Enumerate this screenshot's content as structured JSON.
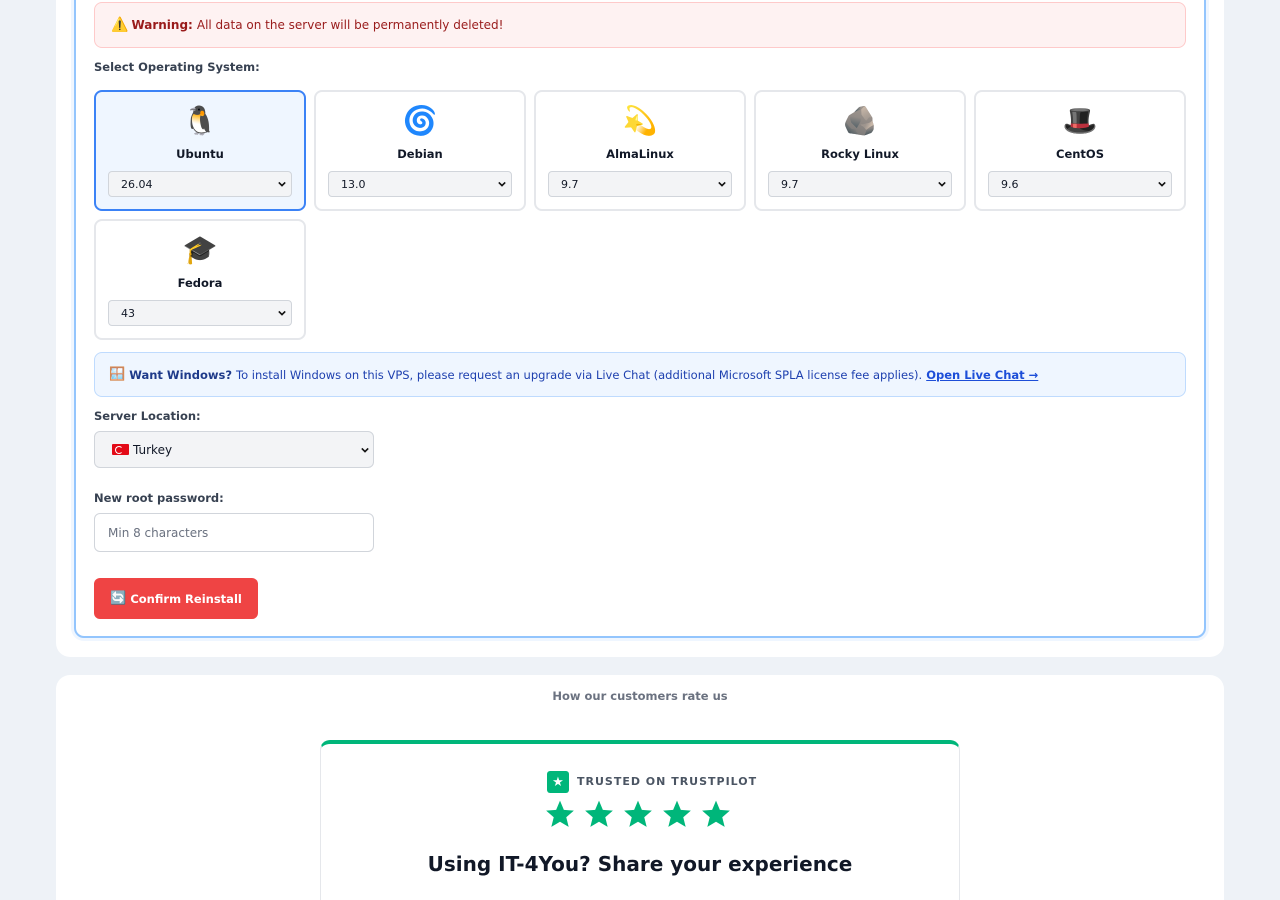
{
  "warning": {
    "icon": "warning-icon",
    "title": "Warning:",
    "text": "All data on the server will be permanently deleted!"
  },
  "os_section": {
    "label": "Select Operating System:",
    "options": [
      {
        "name": "Ubuntu",
        "icon": "🐧",
        "icon_name": "penguin-icon",
        "version": "26.04",
        "selected": true
      },
      {
        "name": "Debian",
        "icon": "🌀",
        "icon_name": "swirl-icon",
        "version": "13.0",
        "selected": false
      },
      {
        "name": "AlmaLinux",
        "icon": "💫",
        "icon_name": "dizzy-star-icon",
        "version": "9.7",
        "selected": false
      },
      {
        "name": "Rocky Linux",
        "icon": "🪨",
        "icon_name": "rock-icon",
        "version": "9.7",
        "selected": false
      },
      {
        "name": "CentOS",
        "icon": "🎩",
        "icon_name": "top-hat-icon",
        "version": "9.6",
        "selected": false
      },
      {
        "name": "Fedora",
        "icon": "🎓",
        "icon_name": "graduation-cap-icon",
        "version": "43",
        "selected": false
      }
    ]
  },
  "windows_note": {
    "icon": "🪟",
    "title": "Want Windows?",
    "text": "To install Windows on this VPS, please request an upgrade via Live Chat (additional Microsoft SPLA license fee applies).",
    "link": "Open Live Chat →"
  },
  "location": {
    "label": "Server Location:",
    "value": "Turkey",
    "flag": "turkey-flag-icon"
  },
  "password": {
    "label": "New root password:",
    "placeholder": "Min 8 characters"
  },
  "confirm_button": {
    "icon": "🔄",
    "label": "Confirm Reinstall"
  },
  "rating": {
    "title": "How our customers rate us",
    "badge": "★",
    "trusted_label": "TRUSTED ON TRUSTPILOT",
    "stars": 5,
    "headline": "Using IT-4You? Share your experience"
  },
  "colors": {
    "accent_blue": "#3b82f6",
    "danger_red": "#ef4444",
    "trustpilot_green": "#00b67a"
  }
}
